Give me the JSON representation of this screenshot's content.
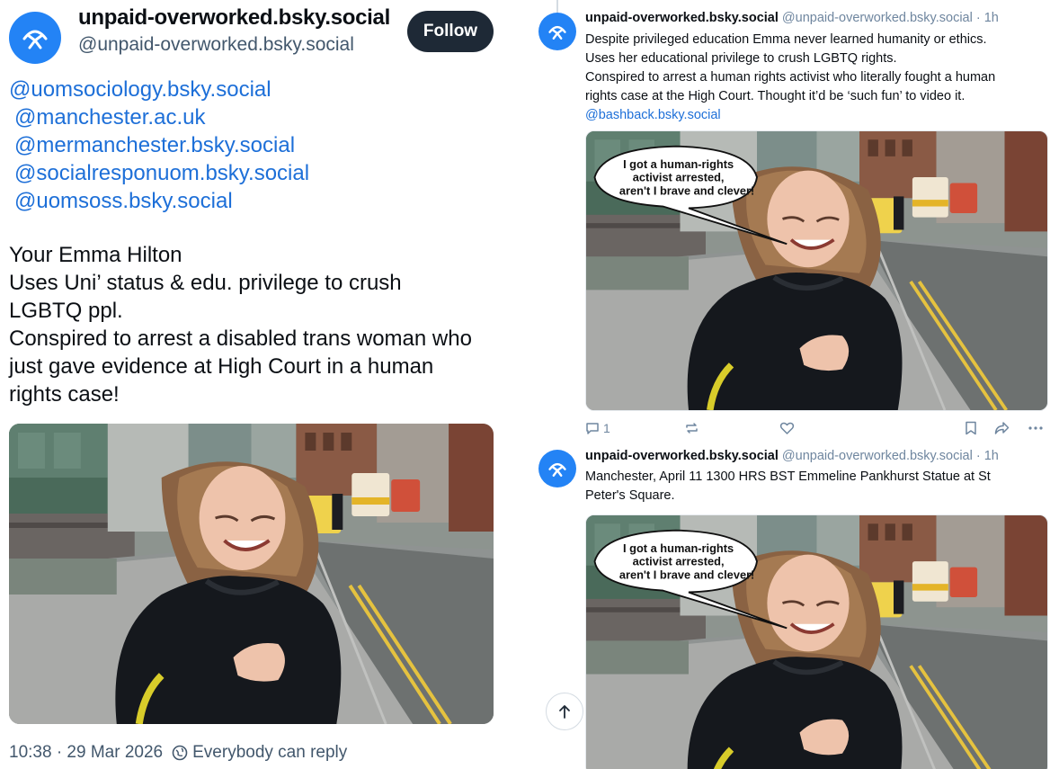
{
  "main_post": {
    "display_name": "unpaid-overworked.bsky.social",
    "handle": "@unpaid-overworked.bsky.social",
    "follow_label": "Follow",
    "mentions": [
      "@uomsociology.bsky.social",
      "@manchester.ac.uk",
      "@mermanchester.bsky.social",
      "@socialresponuom.bsky.social",
      "@uomsoss.bsky.social"
    ],
    "body_lines": [
      "Your Emma Hilton",
      "Uses Uni’ status & edu. privilege to crush",
      "LGBTQ ppl.",
      "Conspired to arrest a disabled trans woman who",
      "just gave evidence at High Court in a human",
      "rights case!"
    ],
    "timestamp": "10:38 · 29 Mar 2026",
    "reply_setting": "Everybody can reply"
  },
  "replies": [
    {
      "display_name": "unpaid-overworked.bsky.social",
      "handle_time": "@unpaid-overworked.bsky.social · 1h",
      "text_lines": [
        "Despite privileged education Emma never learned humanity or ethics.",
        "Uses her educational privilege to crush LGBTQ rights.",
        "Conspired to arrest a human rights activist who literally fought a human",
        "rights case at the High Court. Thought it’d be ‘such fun’ to video it."
      ],
      "link": "@bashback.bsky.social",
      "reply_count": "1"
    },
    {
      "display_name": "unpaid-overworked.bsky.social",
      "handle_time": "@unpaid-overworked.bsky.social · 1h",
      "text_lines": [
        "Manchester, April 11 1300 HRS BST Emmeline Pankhurst Statue at St",
        "Peter's Square."
      ]
    }
  ],
  "speech_bubble": {
    "line1": "I got a human-rights",
    "line2": "activist arrested,",
    "line3": "aren't I brave and clever!"
  },
  "colors": {
    "accent": "#1d6fd8",
    "avatar_bg": "#2383f5",
    "follow_bg": "#1e2936",
    "muted": "#42576c"
  },
  "icons": [
    "butterfly-logo-icon",
    "globe-icon",
    "reply-icon",
    "repost-icon",
    "like-icon",
    "bookmark-icon",
    "share-icon",
    "more-icon",
    "arrow-up-icon"
  ]
}
